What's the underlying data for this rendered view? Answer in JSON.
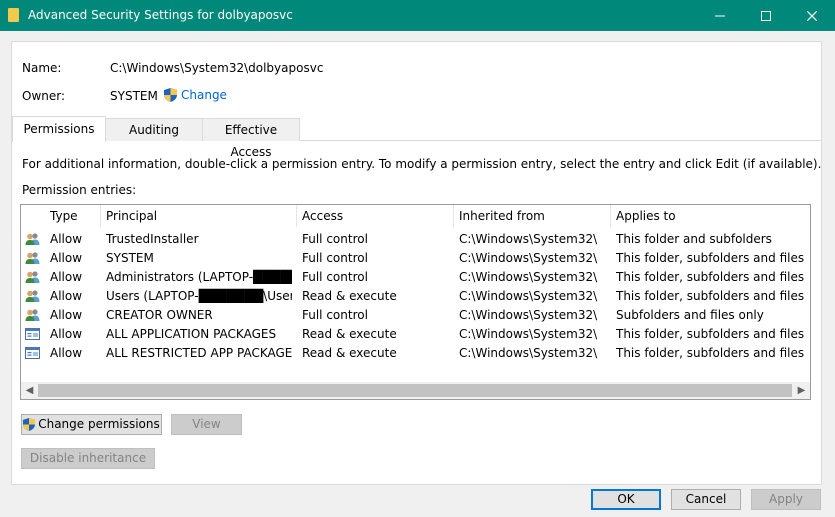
{
  "window": {
    "title": "Advanced Security Settings for dolbyaposvc",
    "controls": [
      "minimize-icon",
      "maximize-icon",
      "close-icon"
    ]
  },
  "name": {
    "label": "Name:",
    "value": "C:\\Windows\\System32\\dolbyaposvc"
  },
  "owner": {
    "label": "Owner:",
    "value": "SYSTEM",
    "change_label": "Change"
  },
  "tabs": [
    {
      "label": "Permissions",
      "active": true
    },
    {
      "label": "Auditing",
      "active": false
    },
    {
      "label": "Effective Access",
      "active": false
    }
  ],
  "info_text": "For additional information, double-click a permission entry. To modify a permission entry, select the entry and click Edit (if available).",
  "entries_label": "Permission entries:",
  "columns": [
    "Type",
    "Principal",
    "Access",
    "Inherited from",
    "Applies to"
  ],
  "entries": [
    {
      "icon": "users-icon",
      "type": "Allow",
      "principal": "TrustedInstaller",
      "access": "Full control",
      "inherited": "C:\\Windows\\System32\\",
      "applies": "This folder and subfolders"
    },
    {
      "icon": "users-icon",
      "type": "Allow",
      "principal": "SYSTEM",
      "access": "Full control",
      "inherited": "C:\\Windows\\System32\\",
      "applies": "This folder, subfolders and files"
    },
    {
      "icon": "users-icon",
      "type": "Allow",
      "principal": "Administrators (LAPTOP-███████.",
      "access": "Full control",
      "inherited": "C:\\Windows\\System32\\",
      "applies": "This folder, subfolders and files"
    },
    {
      "icon": "users-icon",
      "type": "Allow",
      "principal": "Users (LAPTOP-███████\\Users)",
      "access": "Read & execute",
      "inherited": "C:\\Windows\\System32\\",
      "applies": "This folder, subfolders and files"
    },
    {
      "icon": "users-icon",
      "type": "Allow",
      "principal": "CREATOR OWNER",
      "access": "Full control",
      "inherited": "C:\\Windows\\System32\\",
      "applies": "Subfolders and files only"
    },
    {
      "icon": "package-icon",
      "type": "Allow",
      "principal": "ALL APPLICATION PACKAGES",
      "access": "Read & execute",
      "inherited": "C:\\Windows\\System32\\",
      "applies": "This folder, subfolders and files"
    },
    {
      "icon": "package-icon",
      "type": "Allow",
      "principal": "ALL RESTRICTED APP PACKAGES",
      "access": "Read & execute",
      "inherited": "C:\\Windows\\System32\\",
      "applies": "This folder, subfolders and files"
    }
  ],
  "buttons": {
    "change_permissions": "Change permissions",
    "view": "View",
    "disable_inheritance": "Disable inheritance",
    "ok": "OK",
    "cancel": "Cancel",
    "apply": "Apply"
  },
  "colors": {
    "titlebar": "#00897b",
    "link": "#0066cc",
    "focus": "#0078d7"
  }
}
